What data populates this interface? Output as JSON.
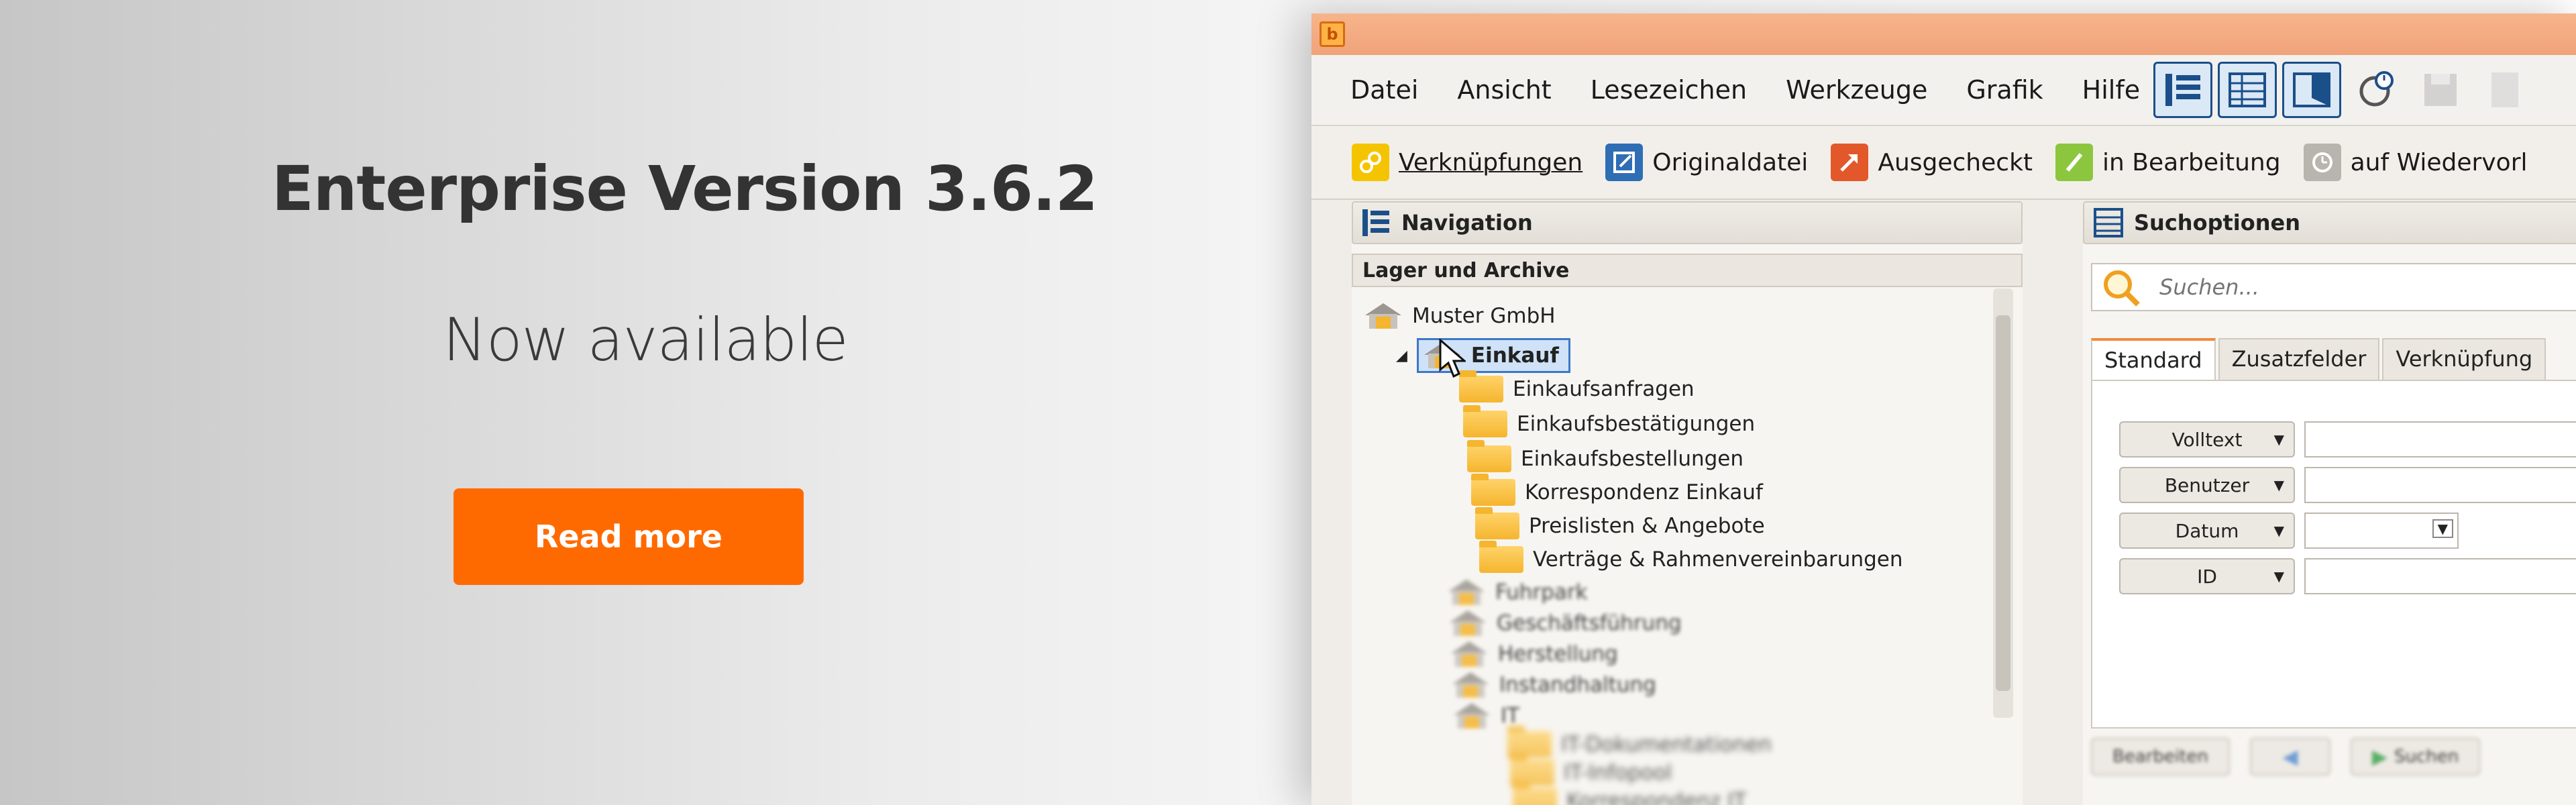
{
  "hero": {
    "title": "Enterprise Version 3.6.2",
    "subtitle": "Now available",
    "cta_label": "Read more",
    "cta_color": "#ff6a00"
  },
  "app": {
    "titlebar_color": "#f0a37a",
    "app_icon_glyph": "b",
    "menu": [
      "Datei",
      "Ansicht",
      "Lesezeichen",
      "Werkzeuge",
      "Grafik",
      "Hilfe"
    ],
    "view_buttons": [
      "tree-view-icon",
      "table-view-icon",
      "split-view-icon",
      "gear-clock-icon",
      "save-icon",
      "pdf-icon"
    ],
    "toolbar": [
      {
        "label": "Verknüpfungen",
        "icon": "link-icon",
        "color": "#f5c400"
      },
      {
        "label": "Originaldatei",
        "icon": "edit-box-icon",
        "color": "#2f6db5"
      },
      {
        "label": "Ausgecheckt",
        "icon": "arrow-out-icon",
        "color": "#e2582a"
      },
      {
        "label": "in Bearbeitung",
        "icon": "pencil-icon",
        "color": "#8cc63e"
      },
      {
        "label": "auf Wiedervorl",
        "icon": "clock-icon",
        "color": "#b8b4ae"
      }
    ],
    "navigation": {
      "title": "Navigation",
      "section": "Lager und Archive",
      "root": "Muster GmbH",
      "selected": "Einkauf",
      "children": [
        "Einkaufsanfragen",
        "Einkaufsbestätigungen",
        "Einkaufsbestellungen",
        "Korrespondenz Einkauf",
        "Preislisten & Angebote",
        "Verträge & Rahmenvereinbarungen"
      ],
      "other_groups": [
        "Fuhrpark",
        "Geschäftsführung",
        "Herstellung",
        "Instandhaltung",
        "IT"
      ],
      "it_children": [
        "IT-Dokumentationen",
        "IT-Infopool",
        "Korrespondenz IT"
      ]
    },
    "search": {
      "title": "Suchoptionen",
      "placeholder": "Suchen...",
      "tabs": [
        "Standard",
        "Zusatzfelder",
        "Verknüpfung"
      ],
      "fields": [
        "Volltext",
        "Benutzer",
        "Datum",
        "ID"
      ],
      "bottom_buttons": [
        "Bearbeiten",
        "Suchen"
      ]
    }
  }
}
